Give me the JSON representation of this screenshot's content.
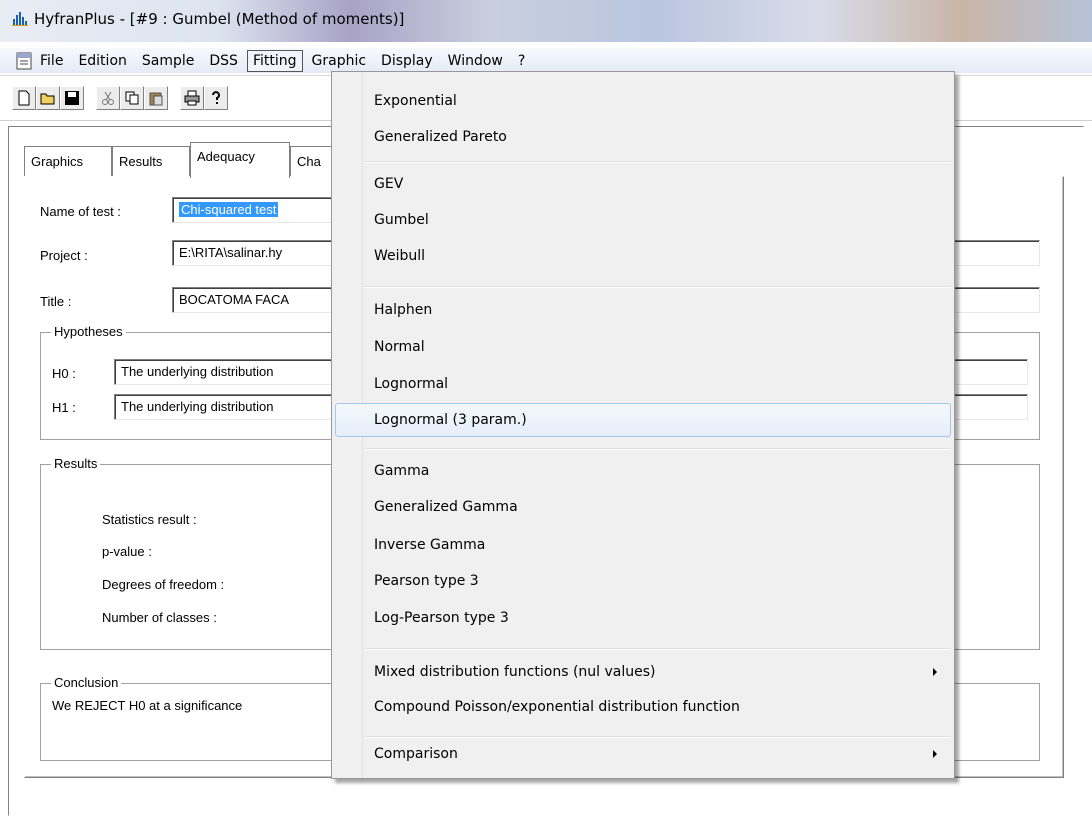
{
  "window": {
    "title": "HyfranPlus - [#9 : Gumbel (Method of moments)]"
  },
  "menubar": {
    "items": [
      "File",
      "Edition",
      "Sample",
      "DSS",
      "Fitting",
      "Graphic",
      "Display",
      "Window",
      "?"
    ],
    "active": "Fitting"
  },
  "toolbar": {
    "buttons": [
      "new-icon",
      "open-icon",
      "save-icon",
      "cut-icon",
      "copy-icon",
      "paste-icon",
      "print-icon",
      "help-icon"
    ]
  },
  "tabs": [
    "Graphics",
    "Results",
    "Adequacy",
    "Cha"
  ],
  "selected_tab": "Adequacy",
  "form": {
    "name_of_test_label": "Name of test :",
    "name_of_test_value": "Chi-squared test",
    "project_label": "Project :",
    "project_value": "E:\\RITA\\salinar.hy",
    "title_label": "Title :",
    "title_value": "BOCATOMA FACA",
    "hypotheses_label": "Hypotheses",
    "h0_label": "H0 :",
    "h0_value": "The underlying distribution",
    "h1_label": "H1 :",
    "h1_value": "The underlying distribution",
    "results_label": "Results",
    "statistics_result_label": "Statistics result :",
    "p_value_label": "p-value :",
    "degrees_of_freedom_label": "Degrees of freedom :",
    "number_of_classes_label": "Number of classes :",
    "conclusion_label": "Conclusion",
    "conclusion_text": "We REJECT H0 at a significance"
  },
  "fitting_menu": {
    "groups": [
      [
        "Exponential",
        "Generalized Pareto"
      ],
      [
        "GEV",
        "Gumbel",
        "Weibull"
      ],
      [
        "Halphen",
        "Normal",
        "Lognormal",
        "Lognormal (3 param.)"
      ],
      [
        "Gamma",
        "Generalized Gamma",
        "Inverse Gamma",
        "Pearson type 3",
        "Log-Pearson type 3"
      ],
      [
        "Mixed distribution functions (nul values)",
        "Compound Poisson/exponential distribution function"
      ],
      [
        "Comparison"
      ]
    ],
    "hovered": "Lognormal (3 param.)",
    "submenu_items": [
      "Mixed distribution functions (nul values)",
      "Comparison"
    ]
  }
}
